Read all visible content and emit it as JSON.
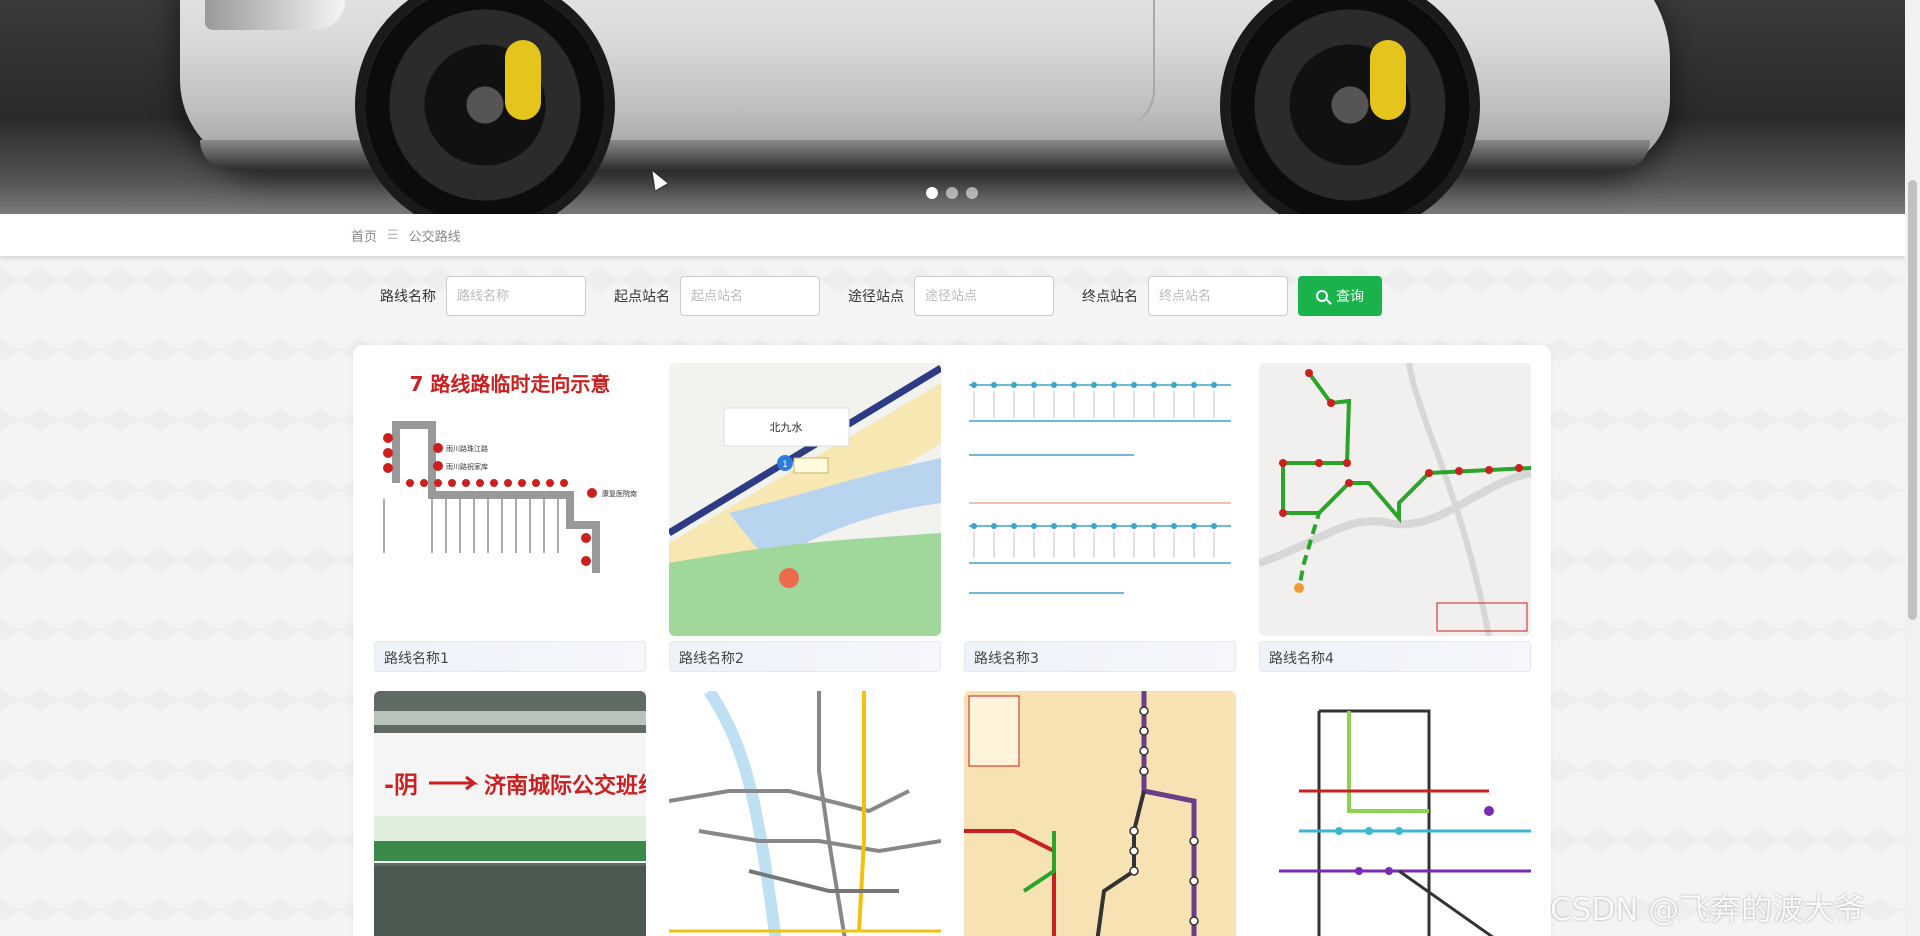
{
  "carousel": {
    "dots": [
      true,
      false,
      false
    ]
  },
  "breadcrumb": {
    "home": "首页",
    "separator": "☰",
    "current": "公交路线"
  },
  "search": {
    "route_name_label": "路线名称",
    "route_name_placeholder": "路线名称",
    "start_label": "起点站名",
    "start_placeholder": "起点站名",
    "via_label": "途径站点",
    "via_placeholder": "途径站点",
    "end_label": "终点站名",
    "end_placeholder": "终点站名",
    "button_label": "查询"
  },
  "cards": [
    {
      "title": "路线名称1",
      "heading": "7 路线路临时走向示意"
    },
    {
      "title": "路线名称2",
      "label": "北九水"
    },
    {
      "title": "路线名称3"
    },
    {
      "title": "路线名称4"
    },
    {
      "title": "",
      "banner": "济南城际公交班线"
    },
    {
      "title": ""
    },
    {
      "title": ""
    },
    {
      "title": ""
    }
  ],
  "watermark": "CSDN @飞奔的波大爷",
  "colors": {
    "accent": "#1ab34b",
    "route_red": "#cc1f1f",
    "route_green": "#2aa52a"
  }
}
